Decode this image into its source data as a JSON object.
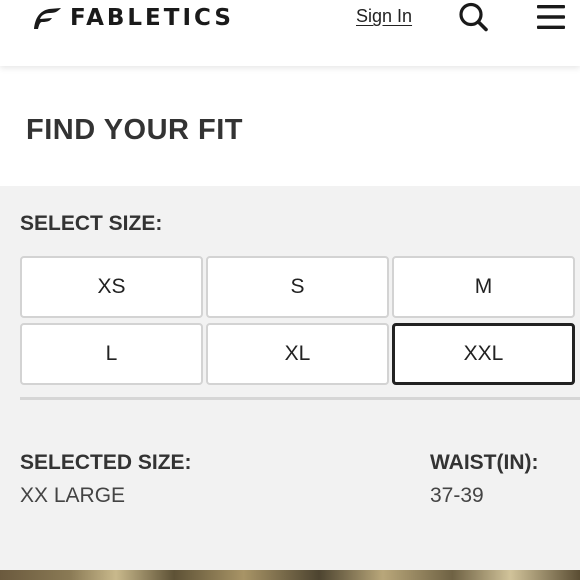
{
  "header": {
    "brand": "FABLETICS",
    "sign_in": "Sign In",
    "search_icon": "search-icon",
    "menu_icon": "hamburger-menu-icon"
  },
  "fit": {
    "title": "FIND YOUR FIT"
  },
  "size_selector": {
    "label": "SELECT SIZE:",
    "options": [
      "XS",
      "S",
      "M",
      "L",
      "XL",
      "XXL"
    ],
    "selected": "XXL"
  },
  "selected_info": {
    "size_label": "SELECTED SIZE:",
    "size_value": "XX LARGE",
    "waist_label": "WAIST(IN):",
    "waist_value": "37-39"
  },
  "colors": {
    "text": "#333333",
    "border": "#d3d3d3",
    "selected_border": "#222222",
    "panel_bg": "#f2f2f2",
    "header_bg": "#ffffff"
  }
}
